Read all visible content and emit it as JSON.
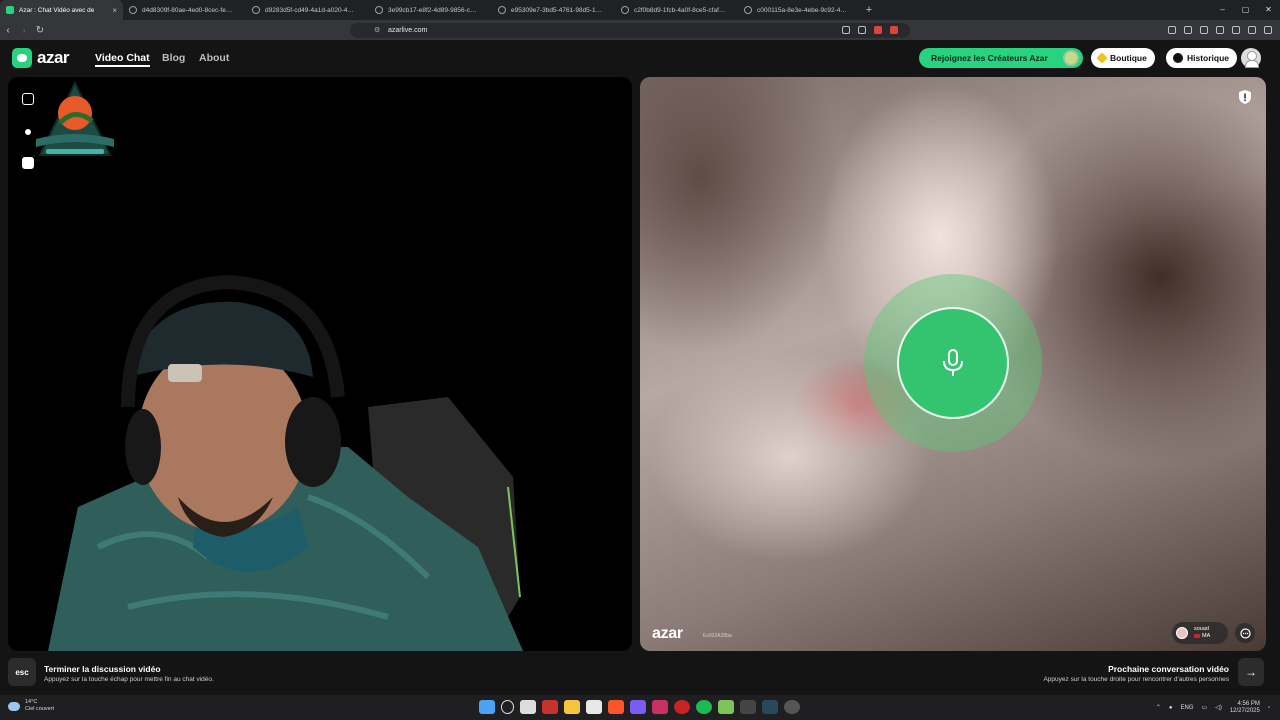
{
  "browser": {
    "tabs": [
      {
        "title": "Azar : Chat Vidéo avec de",
        "active": true
      },
      {
        "title": "d4d8309f-80ae-4ed0-8cec-fe9942a"
      },
      {
        "title": "d9283d5f-cd49-4a1d-a020-4db20fc"
      },
      {
        "title": "3e99cb17-e8f2-4d89-9856-cbb91d"
      },
      {
        "title": "e95309e7-3bd5-4761-98d5-1da6b8"
      },
      {
        "title": "c2f0b8d9-1fcb-4a0f-8ce5-cfaf44d6"
      },
      {
        "title": "c000115a-8e3e-4ebe-9c92-4c2fd02"
      }
    ],
    "url": "azarlive.com",
    "new_tab": "+",
    "close_glyph": "×",
    "window": {
      "minimize": "–",
      "maximize": "▢",
      "close": "✕"
    }
  },
  "nav": {
    "logo_text": "azar",
    "links": [
      "Video Chat",
      "Blog",
      "About"
    ],
    "creators_button": "Rejoignez les Créateurs Azar",
    "shop_button": "Boutique",
    "history_button": "Historique"
  },
  "remote": {
    "watermark": "azar",
    "watermark_id": "Ex922A28ba",
    "partner_name": "souad",
    "partner_country": "MA"
  },
  "bottom": {
    "esc_key": "esc",
    "end_title": "Terminer la discussion vidéo",
    "end_hint": "Appuyez sur la touche échap pour mettre fin au chat vidéo.",
    "next_title": "Prochaine conversation vidéo",
    "next_hint": "Appuyez sur la touche droite pour rencontrer d'autres personnes",
    "next_arrow": "→"
  },
  "taskbar": {
    "temperature": "14°C",
    "weather": "Ciel couvert",
    "language": "ENG",
    "time": "4:56 PM",
    "date": "12/27/2025"
  },
  "colors": {
    "accent": "#27d37e",
    "mic_button": "#34c46f",
    "page_bg": "#141414"
  }
}
